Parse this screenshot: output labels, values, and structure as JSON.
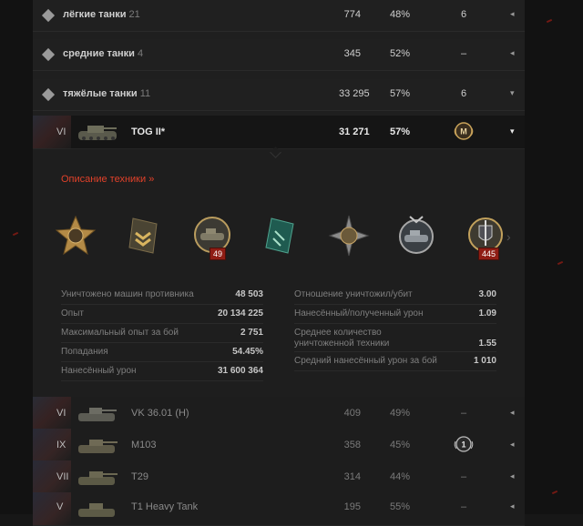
{
  "type_rows": [
    {
      "name": "лёгкие танки",
      "count": "21",
      "battles": "774",
      "win": "48%",
      "mark": "6",
      "arrow": "◂"
    },
    {
      "name": "средние танки",
      "count": "4",
      "battles": "345",
      "win": "52%",
      "mark": "–",
      "arrow": "◂"
    },
    {
      "name": "тяжёлые танки",
      "count": "11",
      "battles": "33 295",
      "win": "57%",
      "mark": "6",
      "arrow": "▾"
    }
  ],
  "selected_tank": {
    "tier": "VI",
    "name": "TOG II*",
    "battles": "31 271",
    "win": "57%",
    "mark": "mastery-badge-M",
    "arrow": "▾"
  },
  "details": {
    "link": "Описание техники »",
    "medals": [
      {
        "icon": "cross-medal-icon",
        "count": ""
      },
      {
        "icon": "chevron-badge-icon",
        "count": ""
      },
      {
        "icon": "tank-medal-icon",
        "count": "49"
      },
      {
        "icon": "green-ribbon-icon",
        "count": ""
      },
      {
        "icon": "star-medal-icon",
        "count": ""
      },
      {
        "icon": "laurel-tank-medal-icon",
        "count": ""
      },
      {
        "icon": "sword-shield-medal-icon",
        "count": "445"
      }
    ],
    "next_arrow": "›",
    "stats_left": [
      {
        "label": "Уничтожено машин противника",
        "value": "48 503"
      },
      {
        "label": "Опыт",
        "value": "20 134 225"
      },
      {
        "label": "Максимальный опыт за бой",
        "value": "2 751"
      },
      {
        "label": "Попадания",
        "value": "54.45%"
      },
      {
        "label": "Нанесённый урон",
        "value": "31 600 364"
      }
    ],
    "stats_right": [
      {
        "label": "Отношение уничтожил/убит",
        "value": "3.00"
      },
      {
        "label": "Нанесённый/полученный урон",
        "value": "1.09"
      },
      {
        "label": "Среднее количество уничтоженной техники",
        "value": "1.55"
      },
      {
        "label": "Средний нанесённый урон за бой",
        "value": "1 010"
      }
    ]
  },
  "tank_rows": [
    {
      "tier": "VI",
      "name": "VK 36.01 (H)",
      "battles": "409",
      "win": "49%",
      "mark": "–",
      "arrow": "◂"
    },
    {
      "tier": "IX",
      "name": "M103",
      "battles": "358",
      "win": "45%",
      "mark": "mastery-badge-1",
      "arrow": "◂"
    },
    {
      "tier": "VII",
      "name": "T29",
      "battles": "314",
      "win": "44%",
      "mark": "–",
      "arrow": "◂"
    },
    {
      "tier": "V",
      "name": "T1 Heavy Tank",
      "battles": "195",
      "win": "55%",
      "mark": "–",
      "arrow": "◂"
    }
  ],
  "badge_texts": {
    "M": "M",
    "one": "1"
  }
}
